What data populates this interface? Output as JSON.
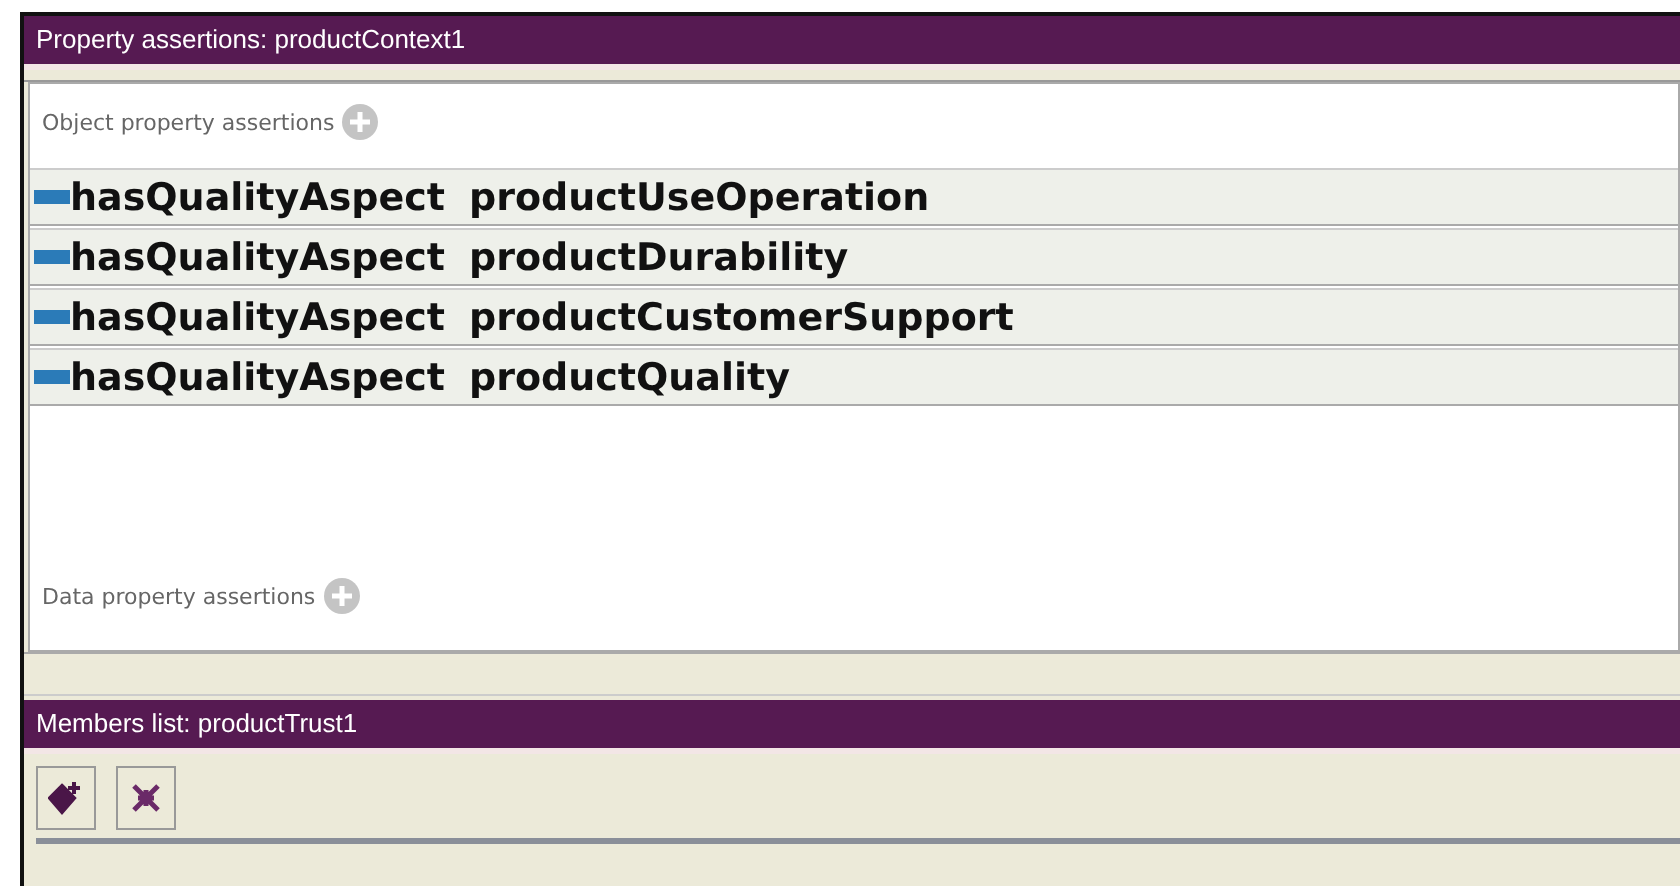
{
  "property_panel": {
    "title": "Property assertions: productContext1",
    "object_section": {
      "label": "Object property assertions"
    },
    "object_assertions": [
      {
        "property": "hasQualityAspect",
        "value": "productUseOperation"
      },
      {
        "property": "hasQualityAspect",
        "value": "productDurability"
      },
      {
        "property": "hasQualityAspect",
        "value": "productCustomerSupport"
      },
      {
        "property": "hasQualityAspect",
        "value": "productQuality"
      }
    ],
    "data_section": {
      "label": "Data property assertions"
    }
  },
  "members_panel": {
    "title": "Members list: productTrust1",
    "toolbar": [
      {
        "kind": "add"
      },
      {
        "kind": "delete"
      }
    ]
  }
}
